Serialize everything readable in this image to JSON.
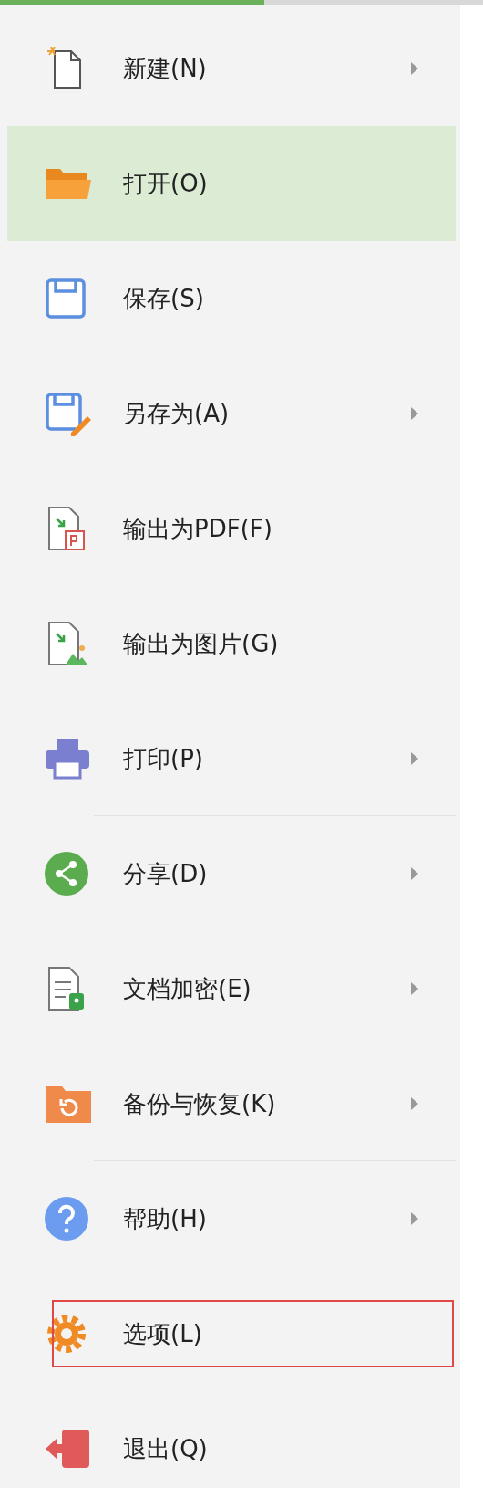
{
  "menu": {
    "items": [
      {
        "kind": "new",
        "label": "新建(N)",
        "submenu": true,
        "selected": false,
        "outlined": false,
        "divider_after": false
      },
      {
        "kind": "open",
        "label": "打开(O)",
        "submenu": false,
        "selected": true,
        "outlined": false,
        "divider_after": false
      },
      {
        "kind": "save",
        "label": "保存(S)",
        "submenu": false,
        "selected": false,
        "outlined": false,
        "divider_after": false
      },
      {
        "kind": "saveas",
        "label": "另存为(A)",
        "submenu": true,
        "selected": false,
        "outlined": false,
        "divider_after": false
      },
      {
        "kind": "pdf",
        "label": "输出为PDF(F)",
        "submenu": false,
        "selected": false,
        "outlined": false,
        "divider_after": false
      },
      {
        "kind": "image",
        "label": "输出为图片(G)",
        "submenu": false,
        "selected": false,
        "outlined": false,
        "divider_after": false
      },
      {
        "kind": "print",
        "label": "打印(P)",
        "submenu": true,
        "selected": false,
        "outlined": false,
        "divider_after": true
      },
      {
        "kind": "share",
        "label": "分享(D)",
        "submenu": true,
        "selected": false,
        "outlined": false,
        "divider_after": false
      },
      {
        "kind": "encrypt",
        "label": "文档加密(E)",
        "submenu": true,
        "selected": false,
        "outlined": false,
        "divider_after": false
      },
      {
        "kind": "backup",
        "label": "备份与恢复(K)",
        "submenu": true,
        "selected": false,
        "outlined": false,
        "divider_after": true
      },
      {
        "kind": "help",
        "label": "帮助(H)",
        "submenu": true,
        "selected": false,
        "outlined": false,
        "divider_after": false
      },
      {
        "kind": "options",
        "label": "选项(L)",
        "submenu": false,
        "selected": false,
        "outlined": true,
        "divider_after": false
      },
      {
        "kind": "exit",
        "label": "退出(Q)",
        "submenu": false,
        "selected": false,
        "outlined": false
      }
    ]
  }
}
